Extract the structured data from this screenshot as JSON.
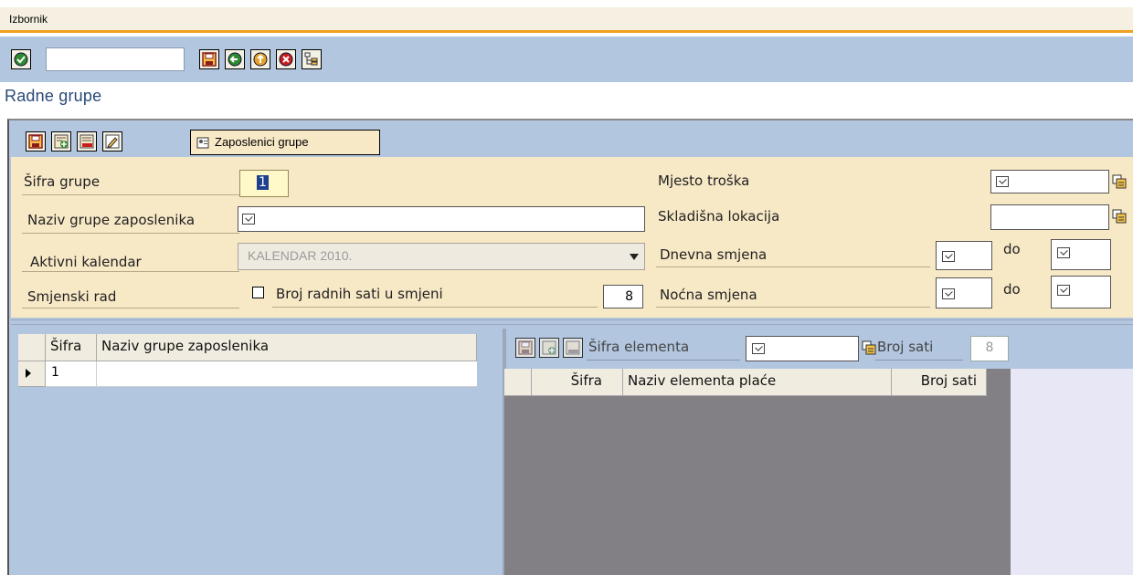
{
  "menubar": {
    "label": "Izbornik"
  },
  "toolbar": {
    "buttons": [
      "check-icon",
      "save-icon",
      "back-icon",
      "up-icon",
      "cancel-icon",
      "tree-icon"
    ],
    "command_value": ""
  },
  "page": {
    "title": "Radne grupe"
  },
  "subtoolbar": {
    "buttons": [
      "save-icon",
      "add-icon",
      "delete-icon",
      "edit-icon"
    ],
    "employees_button": "Zaposlenici grupe"
  },
  "form": {
    "sifra_grupe_label": "Šifra grupe",
    "sifra_grupe_value": "1",
    "naziv_label": "Naziv grupe zaposlenika",
    "naziv_value": "",
    "kalendar_label": "Aktivni kalendar",
    "kalendar_value": "KALENDAR 2010.",
    "smjenski_label": "Smjenski rad",
    "broj_sati_label": "Broj radnih sati u smjeni",
    "broj_sati_value": "8",
    "mjesto_troska_label": "Mjesto troška",
    "skladisna_label": "Skladišna lokacija",
    "dnevna_label": "Dnevna smjena",
    "nocna_label": "Noćna smjena",
    "do_label": "do"
  },
  "left_grid": {
    "columns": [
      "Šifra",
      "Naziv grupe zaposlenika"
    ],
    "rows": [
      {
        "sifra": "1",
        "naziv": ""
      }
    ]
  },
  "right_panel": {
    "sifra_elementa_label": "Šifra elementa",
    "broj_sati_label": "Broj sati",
    "broj_sati_value": "8",
    "columns": [
      "Šifra",
      "Naziv elementa plaće",
      "Broj sati"
    ]
  },
  "colors": {
    "toolbar_bg": "#b3c6df",
    "form_bg": "#f7e8c6",
    "accent": "#f0a020",
    "title": "#2a4a7a"
  }
}
